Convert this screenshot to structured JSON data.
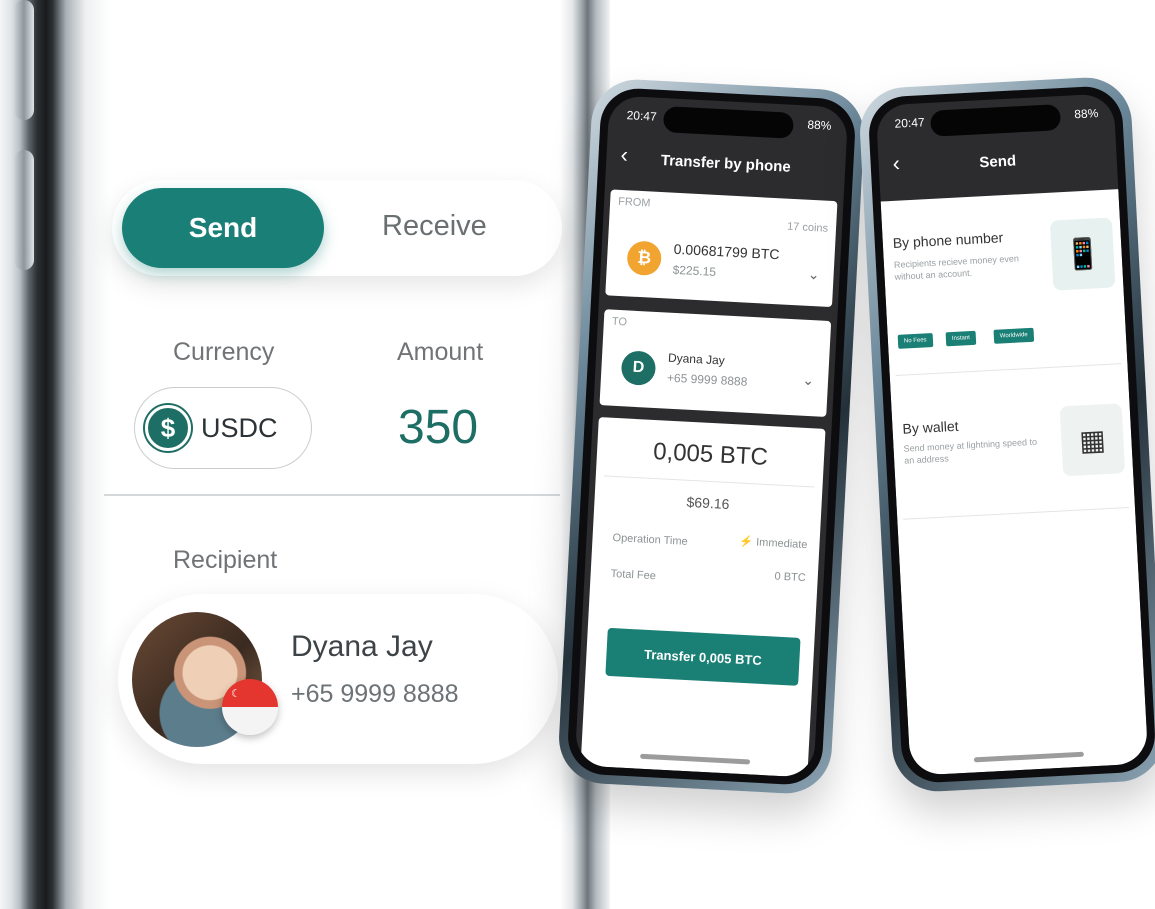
{
  "left": {
    "toggle": {
      "send_label": "Send",
      "receive_label": "Receive"
    },
    "currency_label": "Currency",
    "amount_label": "Amount",
    "currency_code": "USDC",
    "amount_value": "350",
    "recipient_label": "Recipient",
    "recipient_name": "Dyana Jay",
    "recipient_phone": "+65 9999 8888"
  },
  "phone1": {
    "status_time": "20:47",
    "status_battery": "88%",
    "title": "Transfer by phone",
    "from_label": "FROM",
    "coins_count": "17 coins",
    "btc_amount": "0.00681799 BTC",
    "btc_usd": "$225.15",
    "to_label": "TO",
    "to_initial": "D",
    "to_name": "Dyana Jay",
    "to_phone": "+65 9999 8888",
    "amount_big": "0,005",
    "amount_unit": "BTC",
    "amount_usd": "$69.16",
    "operation_time_label": "Operation Time",
    "operation_time_value": "Immediate",
    "total_fee_label": "Total Fee",
    "total_fee_value": "0 BTC",
    "transfer_button": "Transfer  0,005 BTC"
  },
  "phone2": {
    "status_time": "20:47",
    "status_battery": "88%",
    "title": "Send",
    "by_phone_title": "By phone number",
    "by_phone_desc": "Recipients recieve money even without an account.",
    "chips": [
      "No Fees",
      "Instant",
      "Worldwide"
    ],
    "by_wallet_title": "By wallet",
    "by_wallet_desc": "Send money at lightning speed to an address"
  },
  "colors": {
    "accent": "#1a8077",
    "btc": "#f2a431",
    "flag_red": "#e4352f"
  },
  "icons": [
    "back-chevron-icon",
    "bitcoin-icon",
    "chevron-down-icon",
    "lightning-icon",
    "usdc-icon",
    "qr-code-icon",
    "phone-nfc-icon"
  ]
}
